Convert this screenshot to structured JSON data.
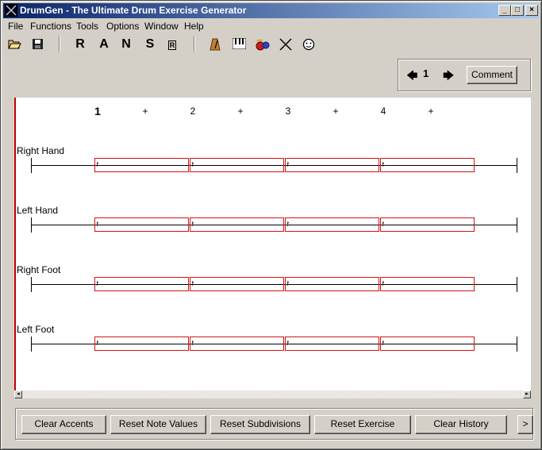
{
  "window": {
    "title": "DrumGen - The Ultimate Drum Exercise Generator",
    "minimize": "_",
    "maximize": "□",
    "close": "×"
  },
  "menu": [
    "File",
    "Functions",
    "Tools",
    "Options",
    "Window",
    "Help"
  ],
  "toolbar": {
    "letters": [
      "R",
      "A",
      "N",
      "S",
      "R"
    ],
    "icons": [
      "open-folder-icon",
      "save-disk-icon",
      "metronome-icon",
      "piano-keys-icon",
      "drum-kit-icon",
      "cross-sticks-icon",
      "smiley-icon"
    ]
  },
  "nav": {
    "prev": "🡄",
    "page": "1",
    "next": "🡆",
    "comment_label": "Comment"
  },
  "beats": [
    "1",
    "+",
    "2",
    "+",
    "3",
    "+",
    "4",
    "+"
  ],
  "rows": [
    {
      "label": "Right Hand"
    },
    {
      "label": "Left Hand"
    },
    {
      "label": "Right Foot"
    },
    {
      "label": "Left Foot"
    }
  ],
  "rest_symbol": "𝄽",
  "bottom_buttons": [
    "Clear Accents",
    "Reset Note Values",
    "Reset Subdivisions",
    "Reset Exercise",
    "Clear History"
  ],
  "more_button": ">",
  "colors": {
    "titlebar_start": "#0a246a",
    "titlebar_end": "#a6caf0",
    "beat_box_border": "#d21414",
    "canvas_left_border": "#c00000"
  }
}
